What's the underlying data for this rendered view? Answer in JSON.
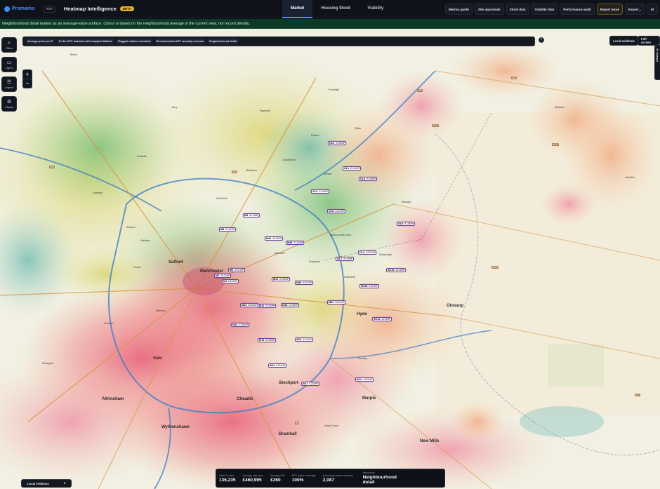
{
  "brand": {
    "name": "Promarks",
    "sub": "Intel"
  },
  "app": {
    "title": "Heatmap Intelligence",
    "badge": "BETA"
  },
  "tabs": [
    {
      "label": "Market",
      "active": true
    },
    {
      "label": "Housing Stock",
      "active": false
    },
    {
      "label": "Viability",
      "active": false
    }
  ],
  "actions": {
    "metrics_guide": "Metrics guide",
    "site_appraisals": "Site appraisals",
    "stock_data": "Stock data",
    "viability_data": "Viability data",
    "performance_audit": "Performance audit",
    "report_issue": "Report issue",
    "export": "Export...",
    "avatar": "M"
  },
  "banner": "Neighbourhood detail loaded as an average-value surface. Colour is based on the neighbourhood average in the current view, not record density.",
  "rail": {
    "filters": "Filters",
    "layers": "Layers",
    "legend": "Legend",
    "display": "Display"
  },
  "zoom": {
    "in": "+",
    "out": "−"
  },
  "chips": [
    "Average price per ft²",
    "Prefer EPC matched with mapped fallback",
    "Flagged outliers excluded",
    "Recommended £/ft² anomaly removal",
    "Neighbourhood detail"
  ],
  "info": "?",
  "right_buttons": {
    "local_evidence": "Local evidence",
    "full_screen": "Full screen"
  },
  "side_tab": "AI Analyst",
  "markers": [
    {
      "code": "OL2",
      "value": "£190/ft²"
    },
    {
      "code": "OL1",
      "value": "£181/ft²"
    },
    {
      "code": "OL4",
      "value": "£189/ft²"
    },
    {
      "code": "OL9",
      "value": "£145/ft²"
    },
    {
      "code": "OL8",
      "value": "£124/ft²"
    },
    {
      "code": "OL5",
      "value": "£185/ft²"
    },
    {
      "code": "M9",
      "value": "£178/ft²"
    },
    {
      "code": "M8",
      "value": "£165/ft²"
    },
    {
      "code": "M40",
      "value": "£153/ft²"
    },
    {
      "code": "M35",
      "value": "£163/ft²"
    },
    {
      "code": "OL6",
      "value": "£201/ft²"
    },
    {
      "code": "OL7",
      "value": "£190/ft²"
    },
    {
      "code": "SK15",
      "value": "£218/ft²"
    },
    {
      "code": "M4",
      "value": "£374/ft²"
    },
    {
      "code": "M2",
      "value": "£423/ft²"
    },
    {
      "code": "M1",
      "value": "£409/ft²"
    },
    {
      "code": "M11",
      "value": "£198/ft²"
    },
    {
      "code": "M43",
      "value": "£202/ft²"
    },
    {
      "code": "SK16",
      "value": "£218/ft²"
    },
    {
      "code": "M13",
      "value": "£250/ft²"
    },
    {
      "code": "M12",
      "value": "£234/ft²"
    },
    {
      "code": "M18",
      "value": "£198/ft²"
    },
    {
      "code": "M34",
      "value": "£201/ft²"
    },
    {
      "code": "SK14",
      "value": "£218/ft²"
    },
    {
      "code": "M14",
      "value": "£256/ft²"
    },
    {
      "code": "M19",
      "value": "£266/ft²"
    },
    {
      "code": "SK5",
      "value": "£234/ft²"
    },
    {
      "code": "SK4",
      "value": "£323/ft²"
    },
    {
      "code": "SK6",
      "value": "£255/ft²"
    },
    {
      "code": "SK1",
      "value": "£235/ft²"
    }
  ],
  "places": [
    "Bolton",
    "Bury",
    "Radcliffe",
    "Heywood",
    "Rochdale",
    "Middleton",
    "Chadderton",
    "Oldham",
    "Royton",
    "Shaw",
    "Kearsley",
    "Walkden",
    "Swinton",
    "Prestwich",
    "Eccles",
    "Salford",
    "Manchester",
    "Stretford",
    "Urmston",
    "Sale",
    "Stockport",
    "Denton",
    "Hyde",
    "Ashton-under-Lyne",
    "Stalybridge",
    "Mossley",
    "Glossop",
    "Marple",
    "Cheadle",
    "Bramhall",
    "Altrincham",
    "Partington",
    "Meltham",
    "Holmfirth",
    "Romiley",
    "Failsworth",
    "Droylsden",
    "Hazel Grove",
    "New Mills",
    "Dukinfield",
    "Whitefield",
    "Wythenshawe"
  ],
  "roads": [
    "A58",
    "A62",
    "A640",
    "A635",
    "A628",
    "M60",
    "M62",
    "A57",
    "A6"
  ],
  "stats": [
    {
      "key": "Sales in view",
      "value": "136,235"
    },
    {
      "key": "Average sale price",
      "value": "£460,995"
    },
    {
      "key": "Average £/ft²",
      "value": "£260"
    },
    {
      "key": "EPC match coverage",
      "value": "100%"
    },
    {
      "key": "Anomalous areas removed",
      "value": "2,087"
    },
    {
      "key": "Resolution",
      "value": "Neighbourhood detail"
    }
  ],
  "local_evidence_dropdown": {
    "label": "Local evidence",
    "chevron": "▾"
  }
}
